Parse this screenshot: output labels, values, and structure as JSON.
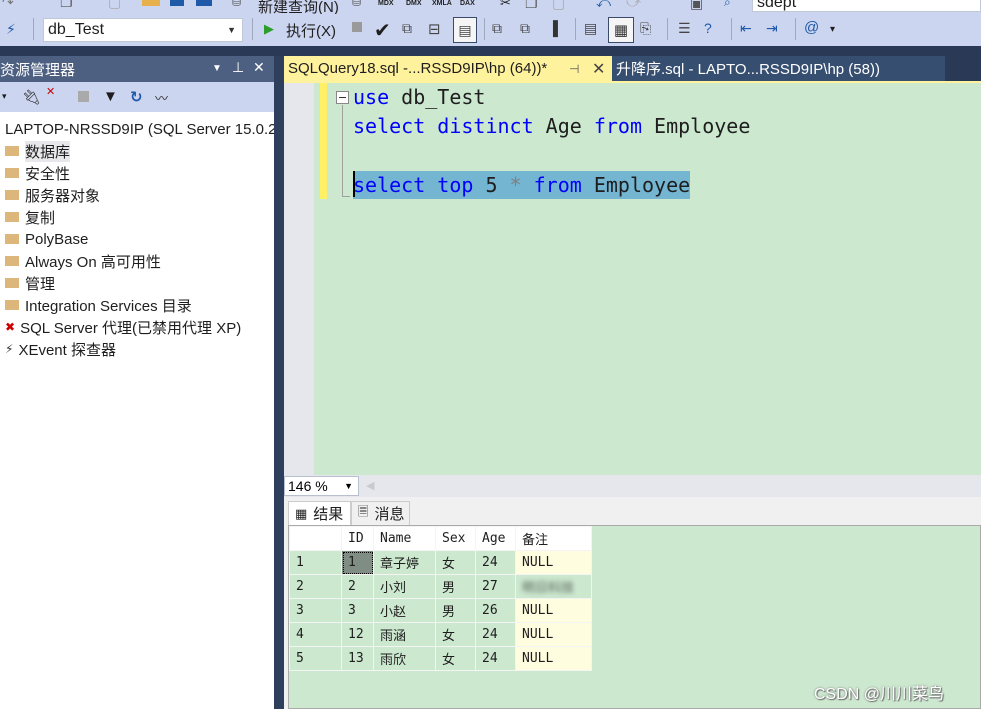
{
  "toolbar": {
    "new_query_label": "新建查询(N)",
    "mdx_label": "MDX",
    "dmx_label": "DMX",
    "xmla_label": "XMLA",
    "dax_label": "DAX",
    "find_combo_value": "sdept",
    "database_combo_value": "db_Test",
    "execute_label": "执行(X)"
  },
  "object_explorer": {
    "title": "资源管理器",
    "server_node": "LAPTOP-NRSSD9IP (SQL Server 15.0.2",
    "items": [
      {
        "label": "数据库",
        "icon": "folder-icon",
        "selected": true
      },
      {
        "label": "安全性",
        "icon": "folder-icon"
      },
      {
        "label": "服务器对象",
        "icon": "folder-icon"
      },
      {
        "label": "复制",
        "icon": "folder-icon"
      },
      {
        "label": "PolyBase",
        "icon": "folder-icon"
      },
      {
        "label": "Always On 高可用性",
        "icon": "folder-icon"
      },
      {
        "label": "管理",
        "icon": "folder-icon"
      },
      {
        "label": "Integration Services 目录",
        "icon": "folder-icon"
      },
      {
        "label": "SQL Server 代理(已禁用代理 XP)",
        "icon": "agent-disabled-icon"
      },
      {
        "label": "XEvent 探查器",
        "icon": "xevent-icon"
      }
    ]
  },
  "tabs": [
    {
      "label": "SQLQuery18.sql -...RSSD9IP\\hp (64))*",
      "active": true
    },
    {
      "label": "升降序.sql - LAPTO...RSSD9IP\\hp (58))",
      "active": false
    }
  ],
  "editor": {
    "lines": [
      [
        {
          "t": "use",
          "k": "kw"
        },
        {
          "t": " db_Test",
          "k": ""
        }
      ],
      [
        {
          "t": "select",
          "k": "kw"
        },
        {
          "t": " ",
          "k": ""
        },
        {
          "t": "distinct",
          "k": "kw"
        },
        {
          "t": " Age ",
          "k": ""
        },
        {
          "t": "from",
          "k": "kw"
        },
        {
          "t": " Employee",
          "k": ""
        }
      ],
      [],
      [
        {
          "t": "select",
          "k": "kw"
        },
        {
          "t": " ",
          "k": ""
        },
        {
          "t": "top",
          "k": "kw"
        },
        {
          "t": " 5 ",
          "k": ""
        },
        {
          "t": "*",
          "k": "op"
        },
        {
          "t": " ",
          "k": ""
        },
        {
          "t": "from",
          "k": "kw"
        },
        {
          "t": " Employee",
          "k": ""
        }
      ]
    ],
    "zoom": "146 %"
  },
  "results": {
    "tabs": [
      "结果",
      "消息"
    ],
    "columns": [
      "",
      "ID",
      "Name",
      "Sex",
      "Age",
      "备注"
    ],
    "rows": [
      [
        "1",
        "1",
        "章子婷",
        "女",
        "24",
        "NULL"
      ],
      [
        "2",
        "2",
        "小刘",
        "男",
        "27",
        "(blurred)"
      ],
      [
        "3",
        "3",
        "小赵",
        "男",
        "26",
        "NULL"
      ],
      [
        "4",
        "12",
        "雨涵",
        "女",
        "24",
        "NULL"
      ],
      [
        "5",
        "13",
        "雨欣",
        "女",
        "24",
        "NULL"
      ]
    ]
  },
  "watermark": "CSDN @川川菜鸟"
}
